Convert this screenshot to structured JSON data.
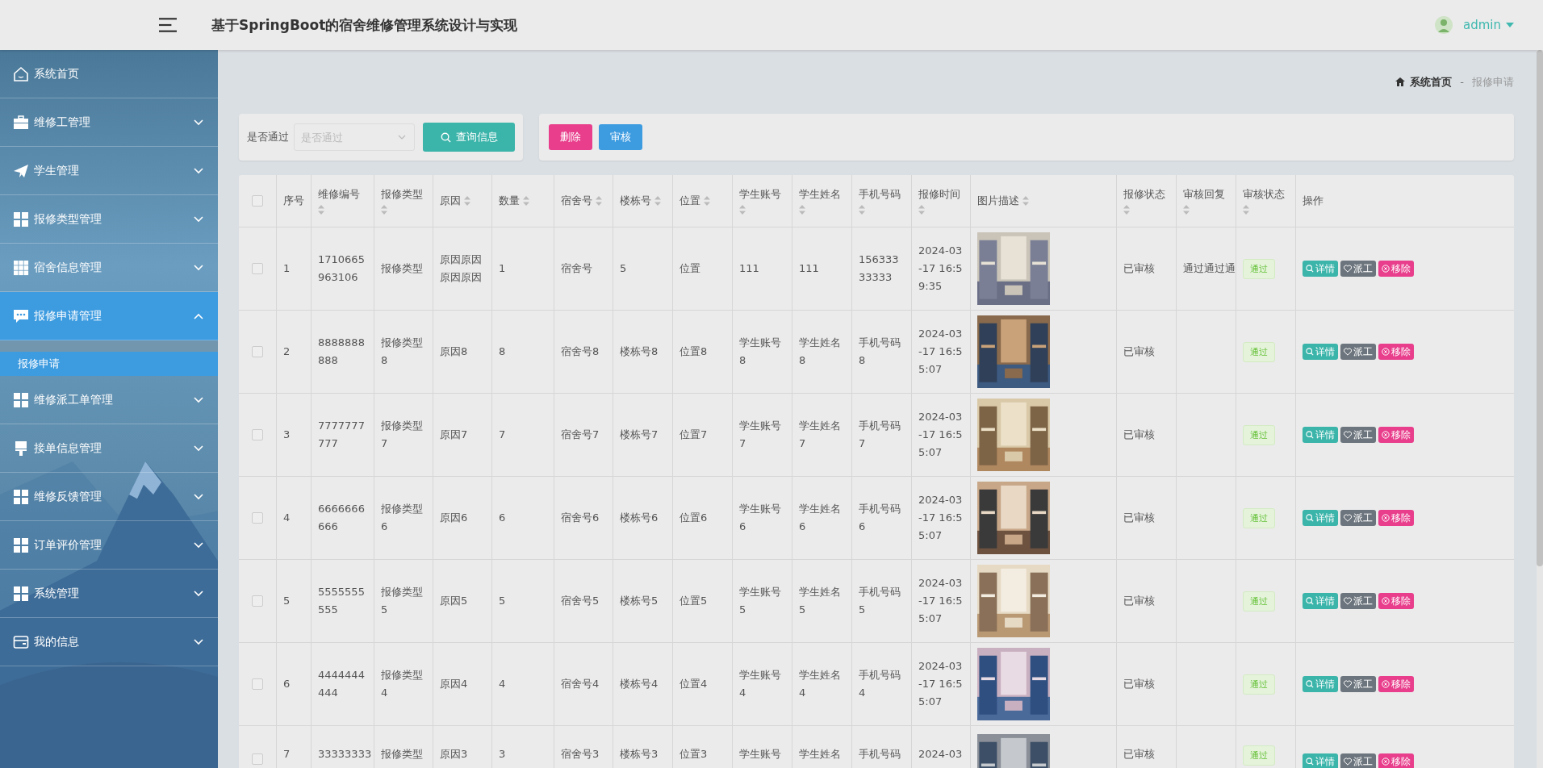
{
  "header": {
    "title": "基于SpringBoot的宿舍维修管理系统设计与实现",
    "user": "admin"
  },
  "sidebar": {
    "items": [
      {
        "label": "系统首页",
        "selected": false
      },
      {
        "label": "维修工管理",
        "expanded": false,
        "selected": false
      },
      {
        "label": "学生管理",
        "expanded": false,
        "selected": false
      },
      {
        "label": "报修类型管理",
        "expanded": false,
        "selected": false
      },
      {
        "label": "宿舍信息管理",
        "expanded": false,
        "selected": false
      },
      {
        "label": "报修申请管理",
        "expanded": true,
        "selected": true,
        "children": [
          {
            "label": "报修申请",
            "selected": true
          }
        ]
      },
      {
        "label": "维修派工单管理",
        "expanded": false,
        "selected": false
      },
      {
        "label": "接单信息管理",
        "expanded": false,
        "selected": false
      },
      {
        "label": "维修反馈管理",
        "expanded": false,
        "selected": false
      },
      {
        "label": "订单评价管理",
        "expanded": false,
        "selected": false
      },
      {
        "label": "系统管理",
        "expanded": false,
        "selected": false
      },
      {
        "label": "我的信息",
        "expanded": false,
        "selected": false
      }
    ]
  },
  "breadcrumb": [
    "系统首页",
    "-",
    "报修申请"
  ],
  "filter": {
    "label": "是否通过",
    "placeholder": "是否通过",
    "button": "查询信息"
  },
  "actions": [
    {
      "label": "删除",
      "kind": "danger"
    },
    {
      "label": "审核",
      "kind": "primary"
    }
  ],
  "table": {
    "select_all_checked": false,
    "columns": [
      {
        "label": "序号",
        "sortable": false
      },
      {
        "label": "维修编号",
        "sortable": true
      },
      {
        "label": "报修类型",
        "sortable": true
      },
      {
        "label": "原因",
        "sortable": true
      },
      {
        "label": "数量",
        "sortable": true
      },
      {
        "label": "宿舍号",
        "sortable": true
      },
      {
        "label": "楼栋号",
        "sortable": true
      },
      {
        "label": "位置",
        "sortable": true
      },
      {
        "label": "学生账号",
        "sortable": true
      },
      {
        "label": "学生姓名",
        "sortable": true
      },
      {
        "label": "手机号码",
        "sortable": true
      },
      {
        "label": "报修时间",
        "sortable": true
      },
      {
        "label": "图片描述",
        "sortable": true
      },
      {
        "label": "报修状态",
        "sortable": true
      },
      {
        "label": "审核回复",
        "sortable": true
      },
      {
        "label": "审核状态",
        "sortable": true
      },
      {
        "label": "操作",
        "sortable": false
      }
    ],
    "rows": [
      {
        "checked": false,
        "cells": [
          "1",
          "1710665963106",
          "报修类型",
          "原因原因原因原因",
          "1",
          "宿舍号",
          "5",
          "位置",
          "111",
          "111",
          "15633333333",
          "2024-03-17 16:59:35"
        ],
        "status": "已审核",
        "reply": "通过通过通",
        "review": "通过",
        "buttons": [
          "详情",
          "派工",
          "移除"
        ]
      },
      {
        "checked": false,
        "cells": [
          "2",
          "8888888888",
          "报修类型8",
          "原因8",
          "8",
          "宿舍号8",
          "楼栋号8",
          "位置8",
          "学生账号8",
          "学生姓名8",
          "手机号码8",
          "2024-03-17 16:55:07"
        ],
        "status": "已审核",
        "review": "通过",
        "buttons": [
          "详情",
          "派工",
          "移除"
        ]
      },
      {
        "checked": false,
        "cells": [
          "3",
          "7777777777",
          "报修类型7",
          "原因7",
          "7",
          "宿舍号7",
          "楼栋号7",
          "位置7",
          "学生账号7",
          "学生姓名7",
          "手机号码7",
          "2024-03-17 16:55:07"
        ],
        "status": "已审核",
        "review": "通过",
        "buttons": [
          "详情",
          "派工",
          "移除"
        ]
      },
      {
        "checked": false,
        "cells": [
          "4",
          "6666666666",
          "报修类型6",
          "原因6",
          "6",
          "宿舍号6",
          "楼栋号6",
          "位置6",
          "学生账号6",
          "学生姓名6",
          "手机号码6",
          "2024-03-17 16:55:07"
        ],
        "status": "已审核",
        "review": "通过",
        "buttons": [
          "详情",
          "派工",
          "移除"
        ]
      },
      {
        "checked": false,
        "cells": [
          "5",
          "5555555555",
          "报修类型5",
          "原因5",
          "5",
          "宿舍号5",
          "楼栋号5",
          "位置5",
          "学生账号5",
          "学生姓名5",
          "手机号码5",
          "2024-03-17 16:55:07"
        ],
        "status": "已审核",
        "review": "通过",
        "buttons": [
          "详情",
          "派工",
          "移除"
        ]
      },
      {
        "checked": false,
        "cells": [
          "6",
          "4444444444",
          "报修类型4",
          "原因4",
          "4",
          "宿舍号4",
          "楼栋号4",
          "位置4",
          "学生账号4",
          "学生姓名4",
          "手机号码4",
          "2024-03-17 16:55:07"
        ],
        "status": "已审核",
        "review": "通过",
        "buttons": [
          "详情",
          "派工",
          "移除"
        ]
      },
      {
        "checked": false,
        "cells": [
          "7",
          "33333333",
          "报修类型",
          "原因3",
          "3",
          "宿舍号3",
          "楼栋号3",
          "位置3",
          "学生账号",
          "学生姓名",
          "手机号码",
          "2024-03"
        ],
        "status": "已审核",
        "review": "通过",
        "buttons": [
          "详情",
          "派工",
          "移除"
        ]
      }
    ]
  }
}
